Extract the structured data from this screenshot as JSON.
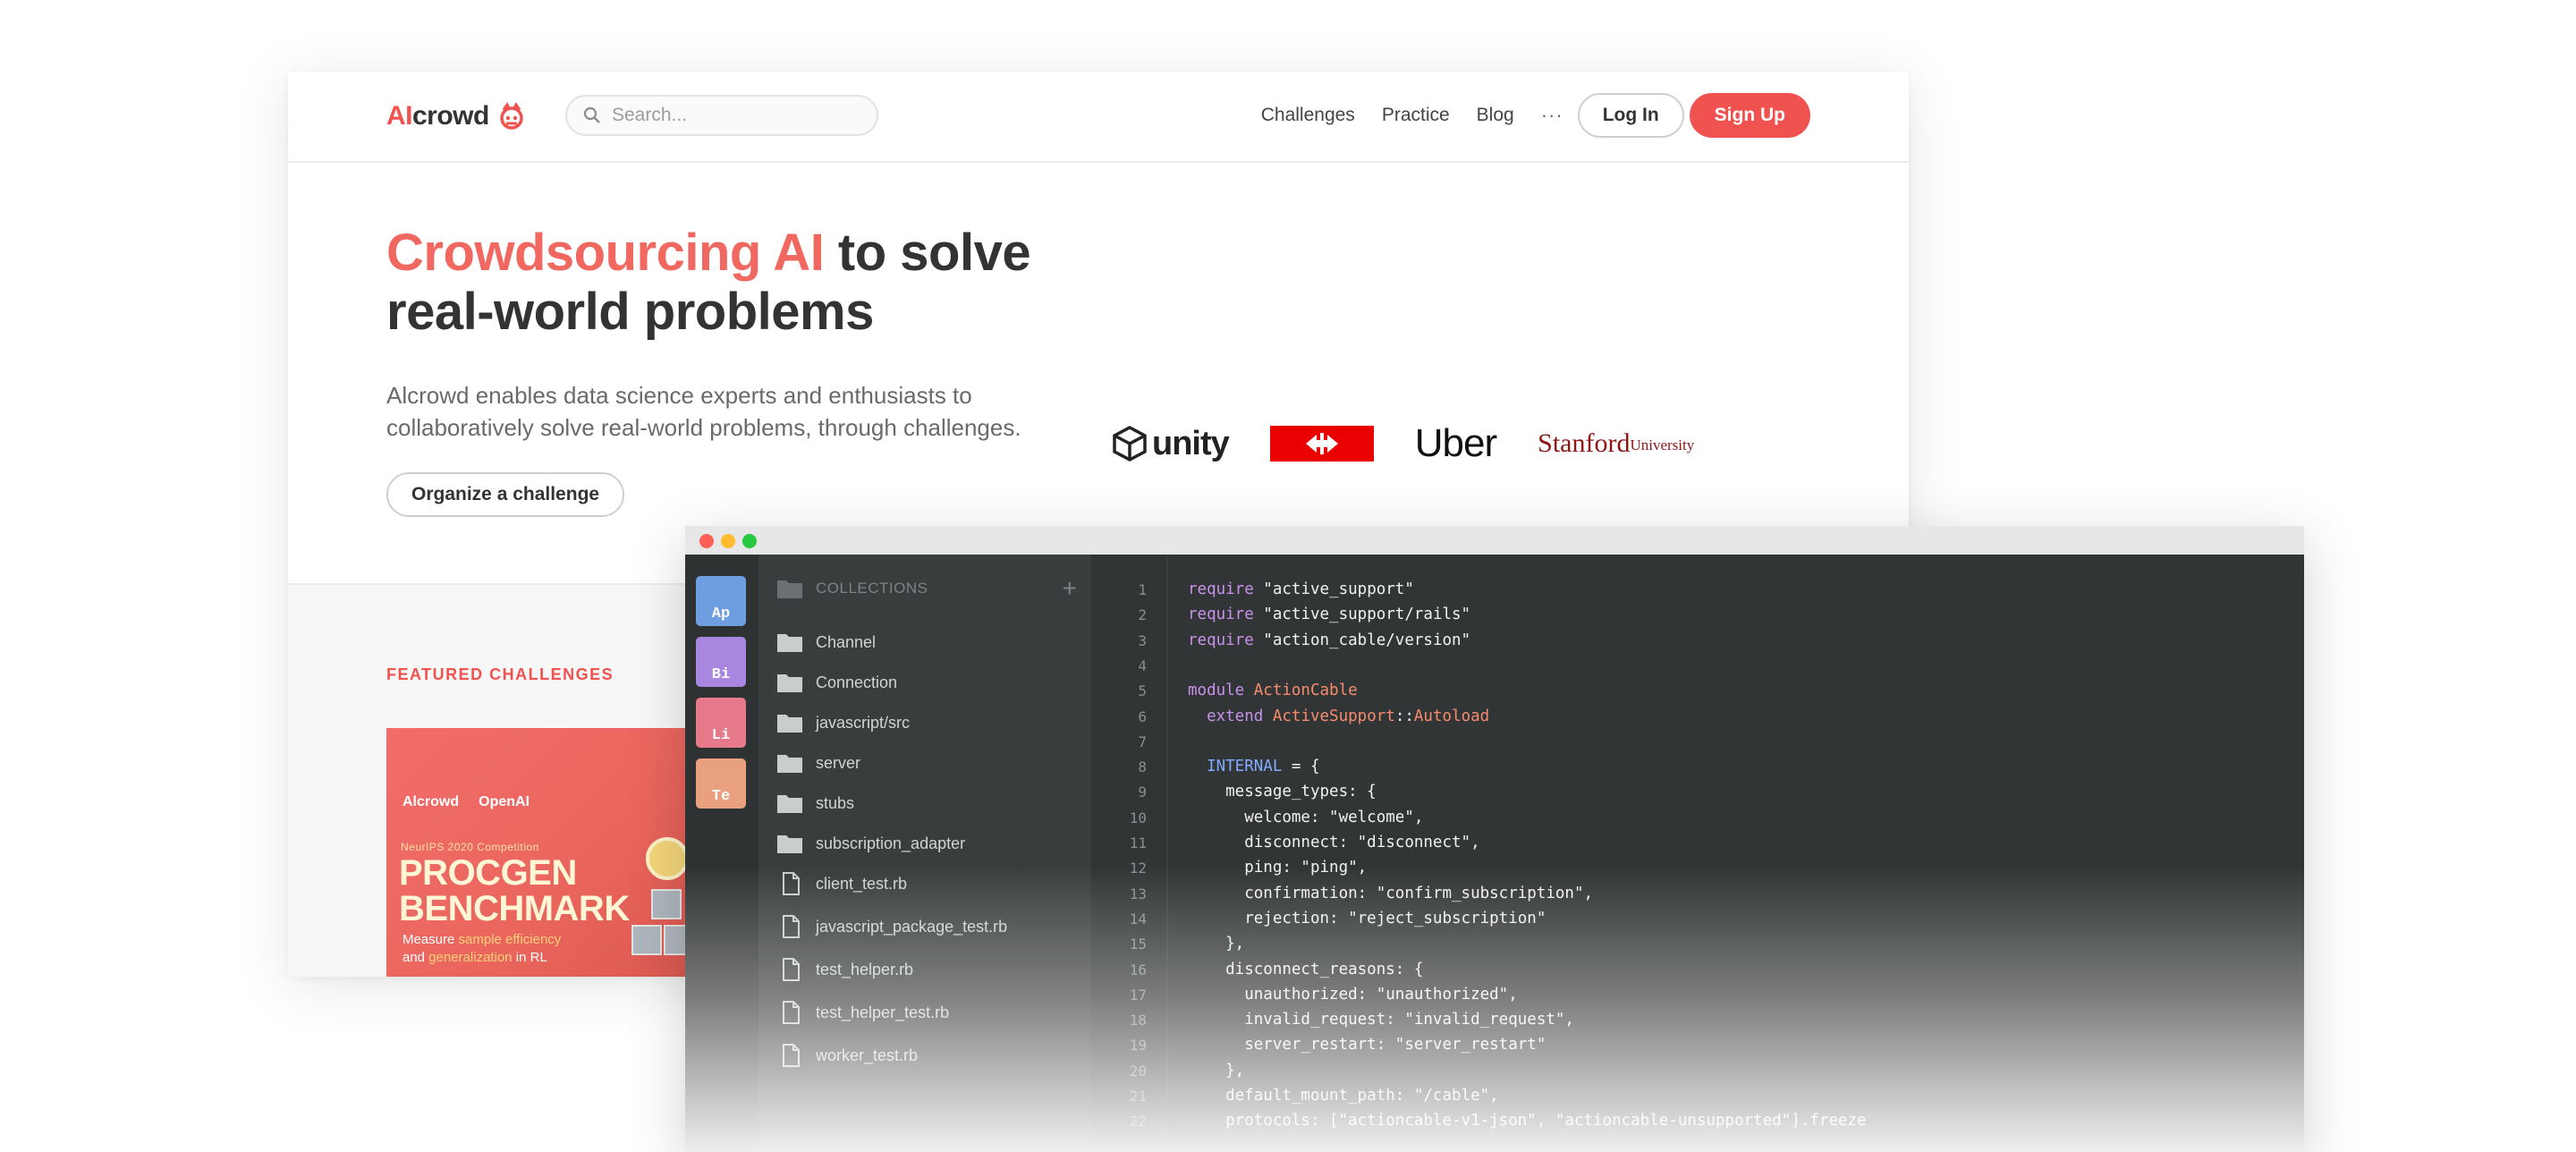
{
  "site": {
    "logo": {
      "ai": "AI",
      "crowd": "crowd"
    },
    "search": {
      "placeholder": "Search..."
    },
    "nav": {
      "links": [
        "Challenges",
        "Practice",
        "Blog"
      ],
      "more": "···",
      "login": "Log In",
      "signup": "Sign Up"
    },
    "hero": {
      "title_accent": "Crowdsourcing AI",
      "title_rest1": " to solve",
      "title_rest2": "real-world problems",
      "description": "Alcrowd enables data science experts and enthusiasts to collaboratively solve real-world problems, through challenges.",
      "cta": "Organize a challenge"
    },
    "partners": {
      "unity": "unity",
      "uber": "Uber",
      "stanford_1": "Stanford",
      "stanford_2": "University"
    },
    "featured": {
      "heading": "FEATURED CHALLENGES",
      "card": {
        "brand1": "Alcrowd",
        "brand2": "OpenAI",
        "subtitle": "NeurIPS 2020 Competition",
        "title_1": "PROCGEN",
        "title_2": "BENCHMARK",
        "desc_1a": "Measure ",
        "desc_1b": "sample efficiency",
        "desc_2a": "and ",
        "desc_2b": "generalization",
        "desc_2c": " in RL"
      }
    }
  },
  "editor": {
    "tiles": [
      {
        "label": "Ap",
        "color": "#6f9ee0"
      },
      {
        "label": "Bi",
        "color": "#a987e0"
      },
      {
        "label": "Li",
        "color": "#e6798a"
      },
      {
        "label": "Te",
        "color": "#e8a07f"
      }
    ],
    "collections_label": "COLLECTIONS",
    "folders": [
      "Channel",
      "Connection",
      "javascript/src",
      "server",
      "stubs",
      "subscription_adapter"
    ],
    "files": [
      "client_test.rb",
      "javascript_package_test.rb",
      "test_helper.rb",
      "test_helper_test.rb",
      "worker_test.rb"
    ],
    "lines": [
      [
        {
          "t": "require",
          "c": "kw"
        },
        {
          "t": " \"active_support\"",
          "c": "str"
        }
      ],
      [
        {
          "t": "require",
          "c": "kw"
        },
        {
          "t": " \"active_support/rails\"",
          "c": "str"
        }
      ],
      [
        {
          "t": "require",
          "c": "kw"
        },
        {
          "t": " \"action_cable/version\"",
          "c": "str"
        }
      ],
      [],
      [
        {
          "t": "module",
          "c": "kw"
        },
        {
          "t": " ActionCable",
          "c": "cst"
        }
      ],
      [
        {
          "t": "  extend",
          "c": "kw"
        },
        {
          "t": " ActiveSupport",
          "c": "cst"
        },
        {
          "t": "::",
          "c": "str"
        },
        {
          "t": "Autoload",
          "c": "cst"
        }
      ],
      [],
      [
        {
          "t": "  INTERNAL",
          "c": "ins"
        },
        {
          "t": " = {",
          "c": "str"
        }
      ],
      [
        {
          "t": "    message_types: {",
          "c": "str"
        }
      ],
      [
        {
          "t": "      welcome: \"welcome\",",
          "c": "str"
        }
      ],
      [
        {
          "t": "      disconnect: \"disconnect\",",
          "c": "str"
        }
      ],
      [
        {
          "t": "      ping: \"ping\",",
          "c": "str"
        }
      ],
      [
        {
          "t": "      confirmation: \"confirm_subscription\",",
          "c": "str"
        }
      ],
      [
        {
          "t": "      rejection: \"reject_subscription\"",
          "c": "str"
        }
      ],
      [
        {
          "t": "    },",
          "c": "str"
        }
      ],
      [
        {
          "t": "    disconnect_reasons: {",
          "c": "str"
        }
      ],
      [
        {
          "t": "      unauthorized: \"unauthorized\",",
          "c": "str"
        }
      ],
      [
        {
          "t": "      invalid_request: \"invalid_request\",",
          "c": "str"
        }
      ],
      [
        {
          "t": "      server_restart: \"server_restart\"",
          "c": "str"
        }
      ],
      [
        {
          "t": "    },",
          "c": "str"
        }
      ],
      [
        {
          "t": "    default_mount_path: \"/cable\",",
          "c": "str"
        }
      ],
      [
        {
          "t": "    protocols: [\"actioncable-v1-json\", \"actioncable-unsupported\"].freeze",
          "c": "str"
        }
      ]
    ]
  }
}
